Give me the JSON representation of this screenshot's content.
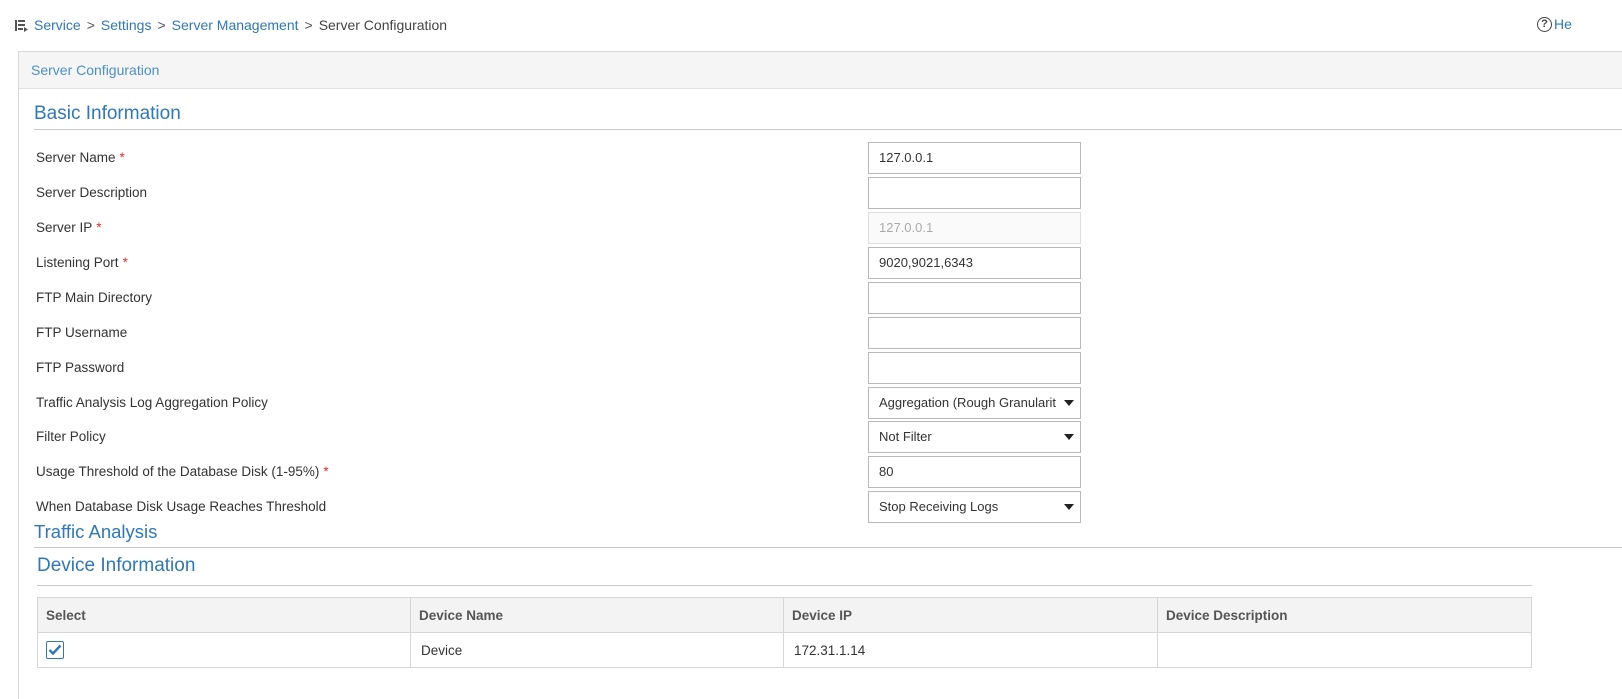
{
  "breadcrumb": {
    "icon": "breadcrumb-nav-icon",
    "items": [
      "Service",
      "Settings",
      "Server Management"
    ],
    "separator": ">",
    "current": "Server Configuration"
  },
  "help": {
    "icon": "help-icon",
    "label": "He"
  },
  "panel": {
    "title": "Server Configuration"
  },
  "sections": {
    "basic": "Basic Information",
    "traffic": "Traffic Analysis",
    "device": "Device Information"
  },
  "form": {
    "server_name": {
      "label": "Server Name",
      "value": "127.0.0.1",
      "required": true
    },
    "server_description": {
      "label": "Server Description",
      "value": ""
    },
    "server_ip": {
      "label": "Server IP",
      "value": "127.0.0.1",
      "required": true,
      "disabled": true
    },
    "listening_port": {
      "label": "Listening Port",
      "value": "9020,9021,6343",
      "required": true
    },
    "ftp_main_directory": {
      "label": "FTP Main Directory",
      "value": ""
    },
    "ftp_username": {
      "label": "FTP Username",
      "value": ""
    },
    "ftp_password": {
      "label": "FTP Password",
      "value": ""
    },
    "aggregation_policy": {
      "label": "Traffic Analysis Log Aggregation Policy",
      "value": "Aggregation (Rough Granularit"
    },
    "filter_policy": {
      "label": "Filter Policy",
      "value": "Not Filter"
    },
    "disk_threshold": {
      "label": "Usage Threshold of the Database Disk (1-95%)",
      "value": "80",
      "required": true
    },
    "threshold_action": {
      "label": "When Database Disk Usage Reaches Threshold",
      "value": "Stop Receiving Logs"
    }
  },
  "required_marker": "*",
  "device_table": {
    "headers": [
      "Select",
      "Device Name",
      "Device IP",
      "Device Description"
    ],
    "rows": [
      {
        "selected": true,
        "name": "Device",
        "ip": "172.31.1.14",
        "description": ""
      }
    ]
  },
  "colors": {
    "link": "#2f78b8",
    "section_title": "#2f78b8",
    "required": "#e03030",
    "header_bg": "#f5f5f5"
  }
}
